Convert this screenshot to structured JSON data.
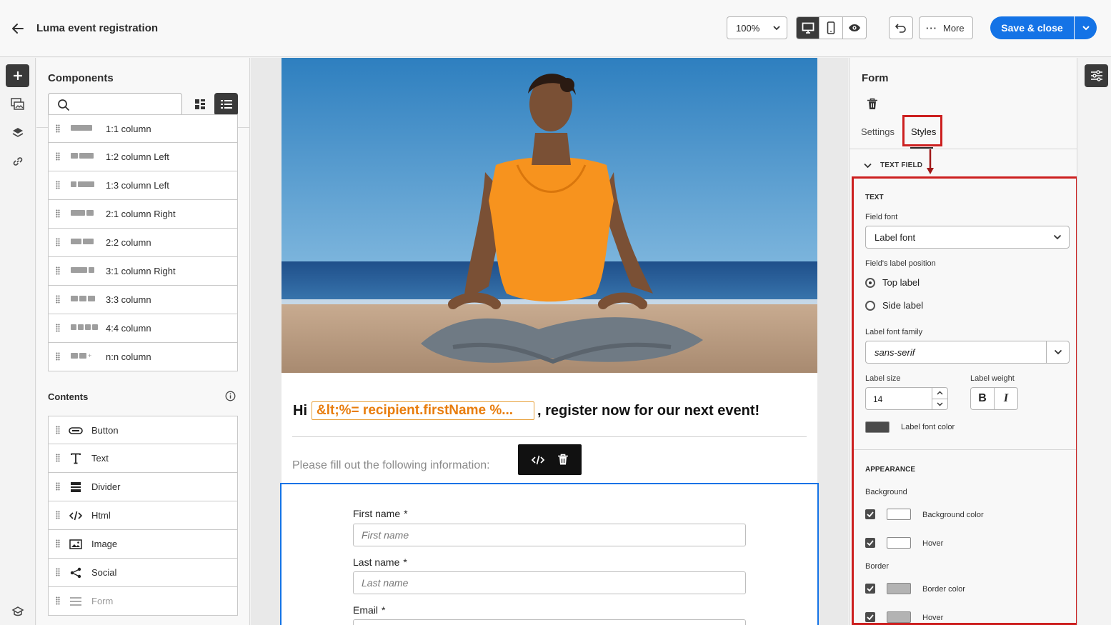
{
  "header": {
    "title": "Luma event registration",
    "zoom": "100%",
    "more_label": "More",
    "save_label": "Save & close"
  },
  "components": {
    "title": "Components",
    "search_placeholder": "",
    "structures": [
      {
        "label": "1:1 column",
        "cols": [
          1
        ]
      },
      {
        "label": "1:2 column Left",
        "cols": [
          1,
          2
        ]
      },
      {
        "label": "1:3 column Left",
        "cols": [
          1,
          3
        ]
      },
      {
        "label": "2:1 column Right",
        "cols": [
          2,
          1
        ]
      },
      {
        "label": "2:2 column",
        "cols": [
          2,
          2
        ]
      },
      {
        "label": "3:1 column Right",
        "cols": [
          3,
          1
        ]
      },
      {
        "label": "3:3 column",
        "cols": [
          1,
          1,
          1
        ]
      },
      {
        "label": "4:4 column",
        "cols": [
          1,
          1,
          1,
          1
        ]
      },
      {
        "label": "n:n column",
        "cols": [
          1,
          1,
          0
        ]
      }
    ],
    "contents_title": "Contents",
    "contents": [
      {
        "label": "Button",
        "icon": "button-icon"
      },
      {
        "label": "Text",
        "icon": "text-icon"
      },
      {
        "label": "Divider",
        "icon": "divider-icon"
      },
      {
        "label": "Html",
        "icon": "html-icon"
      },
      {
        "label": "Image",
        "icon": "image-icon"
      },
      {
        "label": "Social",
        "icon": "social-icon"
      },
      {
        "label": "Form",
        "icon": "form-icon"
      }
    ]
  },
  "email": {
    "greeting": "Hi",
    "token": "&lt;%= recipient.firstName %...",
    "headline_rest": ", register now for our next event!",
    "instructions": "Please fill out the following information:",
    "fields": [
      {
        "label": "First name",
        "required": "*",
        "placeholder": "First name"
      },
      {
        "label": "Last name",
        "required": "*",
        "placeholder": "Last name"
      },
      {
        "label": "Email",
        "required": "*",
        "placeholder": ""
      }
    ]
  },
  "form_panel": {
    "title": "Form",
    "tabs": [
      "Settings",
      "Styles"
    ],
    "active_tab": "Styles",
    "section": "TEXT FIELD",
    "text_heading": "TEXT",
    "field_font_label": "Field font",
    "field_font_value": "Label font",
    "label_position_label": "Field's label position",
    "label_position_options": [
      "Top label",
      "Side label"
    ],
    "label_position_selected": "Top label",
    "label_font_family_label": "Label font family",
    "label_font_family_value": "sans-serif",
    "label_size_label": "Label size",
    "label_size_value": "14",
    "label_weight_label": "Label weight",
    "label_weight_bold": "B",
    "label_weight_italic": "I",
    "label_font_color_label": "Label font color",
    "label_font_color": "#4b4b4b",
    "appearance_heading": "APPEARANCE",
    "background_heading": "Background",
    "background_color_label": "Background color",
    "background_hover_label": "Hover",
    "border_heading": "Border",
    "border_color_label": "Border color",
    "border_hover_label": "Hover"
  },
  "colors": {
    "accent": "#1473e6",
    "highlight": "#cc1f1f",
    "token": "#e87d0d"
  }
}
